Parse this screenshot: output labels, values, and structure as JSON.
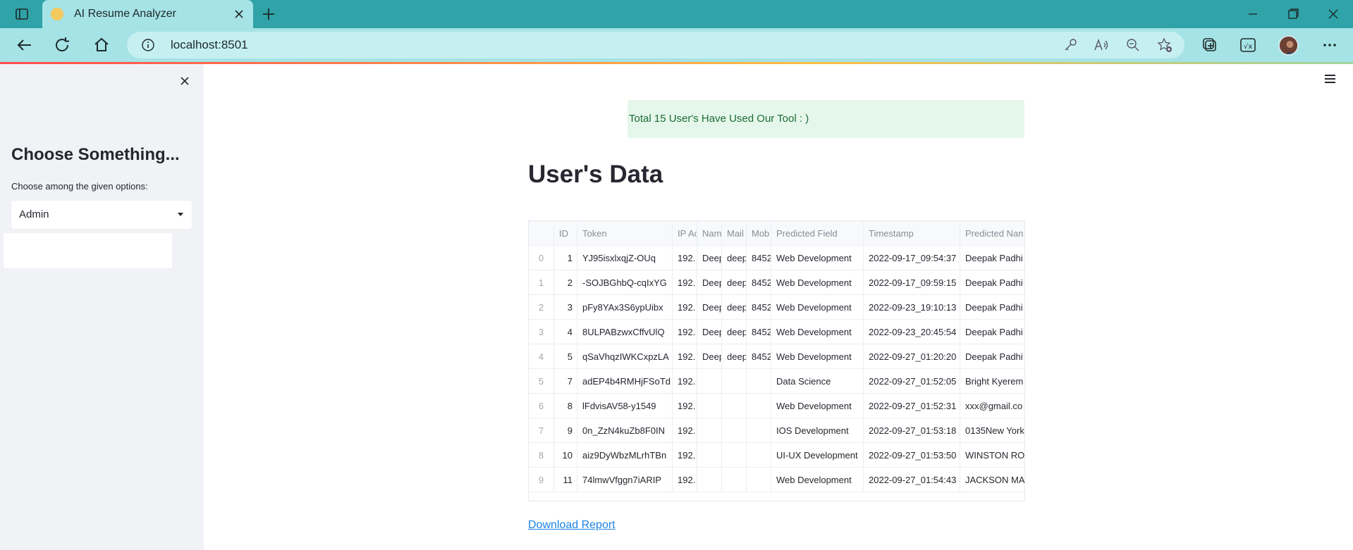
{
  "browser": {
    "tab_title": "AI Resume Analyzer",
    "address": "localhost:8501"
  },
  "sidebar": {
    "heading": "Choose Something...",
    "select_label": "Choose among the given options:",
    "select_value": "Admin"
  },
  "main": {
    "success_message": "Total 15 User's Have Used Our Tool : )",
    "title": "User's Data",
    "download_link": "Download Report"
  },
  "table": {
    "columns": [
      "",
      "ID",
      "Token",
      "IP Ac",
      "Nam",
      "Mail",
      "Mob",
      "Predicted Field",
      "Timestamp",
      "Predicted Nan"
    ],
    "rows": [
      [
        "0",
        "1",
        "YJ95isxlxqjZ-OUq",
        "192.",
        "Deep",
        "deep",
        "8452",
        "Web Development",
        "2022-09-17_09:54:37",
        "Deepak Padhi"
      ],
      [
        "1",
        "2",
        "-SOJBGhbQ-cqIxYG",
        "192.",
        "Deep",
        "deep",
        "8452",
        "Web Development",
        "2022-09-17_09:59:15",
        "Deepak Padhi"
      ],
      [
        "2",
        "3",
        "pFy8YAx3S6ypUibx",
        "192.",
        "Deep",
        "deep",
        "8452",
        "Web Development",
        "2022-09-23_19:10:13",
        "Deepak Padhi"
      ],
      [
        "3",
        "4",
        "8ULPABzwxCffvUlQ",
        "192.",
        "Deep",
        "deep",
        "8452",
        "Web Development",
        "2022-09-23_20:45:54",
        "Deepak Padhi"
      ],
      [
        "4",
        "5",
        "qSaVhqzIWKCxpzLA",
        "192.",
        "Deep",
        "deep",
        "8452",
        "Web Development",
        "2022-09-27_01:20:20",
        "Deepak Padhi"
      ],
      [
        "5",
        "7",
        "adEP4b4RMHjFSoTd",
        "192.",
        "",
        "",
        "",
        "Data Science",
        "2022-09-27_01:52:05",
        "Bright Kyerem"
      ],
      [
        "6",
        "8",
        "lFdvisAV58-y1549",
        "192.",
        "",
        "",
        "",
        "Web Development",
        "2022-09-27_01:52:31",
        "xxx@gmail.co"
      ],
      [
        "7",
        "9",
        "0n_ZzN4kuZb8F0IN",
        "192.",
        "",
        "",
        "",
        "IOS Development",
        "2022-09-27_01:53:18",
        "0135New York"
      ],
      [
        "8",
        "10",
        "aiz9DyWbzMLrhTBn",
        "192.",
        "",
        "",
        "",
        "UI-UX Development",
        "2022-09-27_01:53:50",
        "WINSTON ROS"
      ],
      [
        "9",
        "11",
        "74lmwVfggn7iARIP",
        "192.",
        "",
        "",
        "",
        "Web Development",
        "2022-09-27_01:54:43",
        "JACKSON MAC"
      ]
    ]
  }
}
